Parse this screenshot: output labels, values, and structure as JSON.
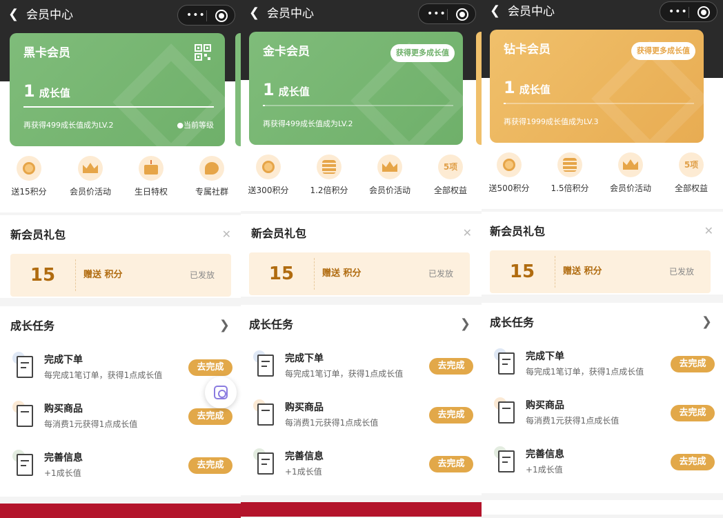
{
  "app": {
    "nav_title": "会员中心",
    "back_icon": "chevron-left-icon",
    "capsule": {
      "more_icon": "more-dots-icon",
      "close_icon": "target-icon"
    }
  },
  "screens": [
    {
      "card": {
        "level_name": "黑卡会员",
        "points": "1",
        "points_unit": "成长值",
        "progress_fraction": 1.0,
        "hint": "再获得499成长值成为LV.2",
        "current_label": "当前等级",
        "color": "#75b570",
        "corner": "qr-code-icon"
      },
      "perks": [
        {
          "label": "送15积分",
          "icon": "points-coin-icon"
        },
        {
          "label": "会员价活动",
          "icon": "crown-icon"
        },
        {
          "label": "生日特权",
          "icon": "birthday-cake-icon"
        },
        {
          "label": "专属社群",
          "icon": "chat-bubble-icon"
        }
      ],
      "gift": {
        "title": "新会员礼包",
        "amount": "15",
        "text": "赠送 积分",
        "status": "已发放"
      },
      "tasks_title": "成长任务",
      "tasks": [
        {
          "name": "完成下单",
          "desc": "每完成1笔订单，获得1点成长值",
          "btn": "去完成",
          "icon": "order-document-icon"
        },
        {
          "name": "购买商品",
          "desc": "每消费1元获得1点成长值",
          "btn": "去完成",
          "icon": "shopping-bag-icon"
        },
        {
          "name": "完善信息",
          "desc": "+1成长值",
          "btn": "去完成",
          "icon": "profile-form-icon"
        }
      ]
    },
    {
      "card": {
        "level_name": "金卡会员",
        "points": "1",
        "points_unit": "成长值",
        "progress_fraction": 0.01,
        "hint": "再获得499成长值成为LV.2",
        "more_btn": "获得更多成长值",
        "color": "#75b570"
      },
      "perks": [
        {
          "label": "送300积分",
          "icon": "points-coin-icon"
        },
        {
          "label": "1.2倍积分",
          "icon": "coins-stack-icon"
        },
        {
          "label": "会员价活动",
          "icon": "crown-icon"
        },
        {
          "label": "全部权益",
          "icon": "5项"
        }
      ],
      "gift": {
        "title": "新会员礼包",
        "amount": "15",
        "text": "赠送 积分",
        "status": "已发放"
      },
      "tasks_title": "成长任务",
      "tasks": [
        {
          "name": "完成下单",
          "desc": "每完成1笔订单，获得1点成长值",
          "btn": "去完成",
          "icon": "order-document-icon"
        },
        {
          "name": "购买商品",
          "desc": "每消费1元获得1点成长值",
          "btn": "去完成",
          "icon": "shopping-bag-icon"
        },
        {
          "name": "完善信息",
          "desc": "+1成长值",
          "btn": "去完成",
          "icon": "profile-form-icon"
        }
      ]
    },
    {
      "card": {
        "level_name": "钻卡会员",
        "points": "1",
        "points_unit": "成长值",
        "progress_fraction": 0.01,
        "hint": "再获得1999成长值成为LV.3",
        "more_btn": "获得更多成长值",
        "color": "#eab45c"
      },
      "perks": [
        {
          "label": "送500积分",
          "icon": "points-coin-icon"
        },
        {
          "label": "1.5倍积分",
          "icon": "coins-stack-icon"
        },
        {
          "label": "会员价活动",
          "icon": "crown-icon"
        },
        {
          "label": "全部权益",
          "icon": "5项"
        }
      ],
      "gift": {
        "title": "新会员礼包",
        "amount": "15",
        "text": "赠送 积分",
        "status": "已发放"
      },
      "tasks_title": "成长任务",
      "tasks": [
        {
          "name": "完成下单",
          "desc": "每完成1笔订单，获得1点成长值",
          "btn": "去完成",
          "icon": "order-document-icon"
        },
        {
          "name": "购买商品",
          "desc": "每消费1元获得1点成长值",
          "btn": "去完成",
          "icon": "shopping-bag-icon"
        },
        {
          "name": "完善信息",
          "desc": "+1成长值",
          "btn": "去完成",
          "icon": "profile-form-icon"
        }
      ]
    }
  ],
  "floating": {
    "scan_icon": "scan-lens-icon"
  }
}
